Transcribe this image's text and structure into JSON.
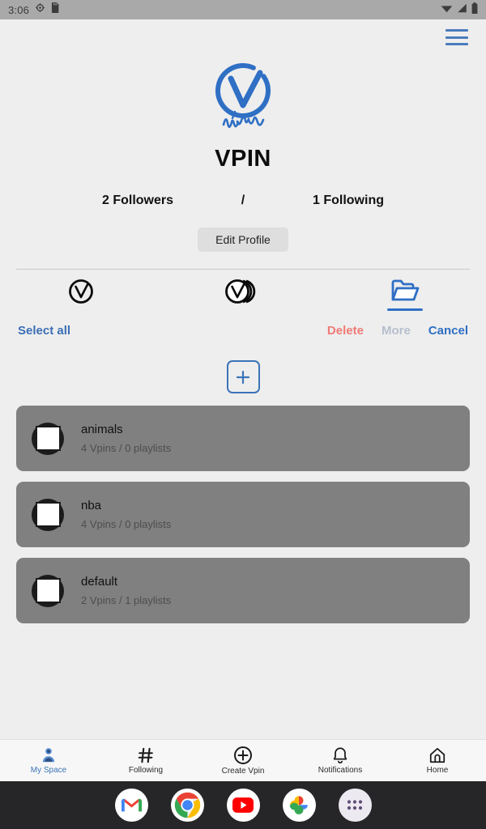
{
  "statusbar": {
    "time": "3:06",
    "icons": [
      "settings-icon",
      "sdcard-icon",
      "wifi-icon",
      "signal-icon",
      "battery-icon"
    ]
  },
  "topbar": {
    "menu_icon": "hamburger-menu-icon"
  },
  "profile": {
    "logo_alt": "vpin-logo",
    "brand": "VPIN",
    "followers": "2 Followers",
    "separator": "/",
    "following": "1 Following",
    "edit_profile_label": "Edit Profile"
  },
  "tabs": [
    {
      "name": "vpins",
      "icon": "vpin-check-circle-icon",
      "active": false
    },
    {
      "name": "playlists",
      "icon": "vpin-stack-icon",
      "active": false
    },
    {
      "name": "folders",
      "icon": "folder-open-icon",
      "active": true
    }
  ],
  "actions": {
    "select_all": "Select all",
    "delete": "Delete",
    "more": "More",
    "cancel": "Cancel",
    "delete_color": "#ef7b75",
    "more_color": "#b6bfcd",
    "cancel_color": "#2f6fc4",
    "select_all_color": "#3c6fb5"
  },
  "add_button": {
    "label": "+",
    "name": "add-folder-button"
  },
  "folders": [
    {
      "title": "animals",
      "subtitle": "4 Vpins / 0 playlists",
      "selected": false
    },
    {
      "title": "nba",
      "subtitle": "4 Vpins / 0 playlists",
      "selected": false
    },
    {
      "title": "default",
      "subtitle": "2 Vpins / 1 playlists",
      "selected": false
    }
  ],
  "bottom_nav": [
    {
      "label": "My Space",
      "icon": "person-icon",
      "active": true
    },
    {
      "label": "Following",
      "icon": "hash-icon",
      "active": false
    },
    {
      "label": "Create Vpin",
      "icon": "plus-circle-icon",
      "active": false
    },
    {
      "label": "Notifications",
      "icon": "bell-icon",
      "active": false
    },
    {
      "label": "Home",
      "icon": "home-icon",
      "active": false
    }
  ],
  "dock": [
    {
      "name": "gmail-icon"
    },
    {
      "name": "chrome-icon"
    },
    {
      "name": "youtube-icon"
    },
    {
      "name": "google-photos-icon"
    },
    {
      "name": "app-drawer-icon"
    }
  ],
  "theme": {
    "background": "#eeeeee",
    "list_item_bg": "#808080",
    "accent_blue": "#3c74b8",
    "status_bar_bg": "#a9a9a9",
    "dock_bg": "#262628"
  }
}
